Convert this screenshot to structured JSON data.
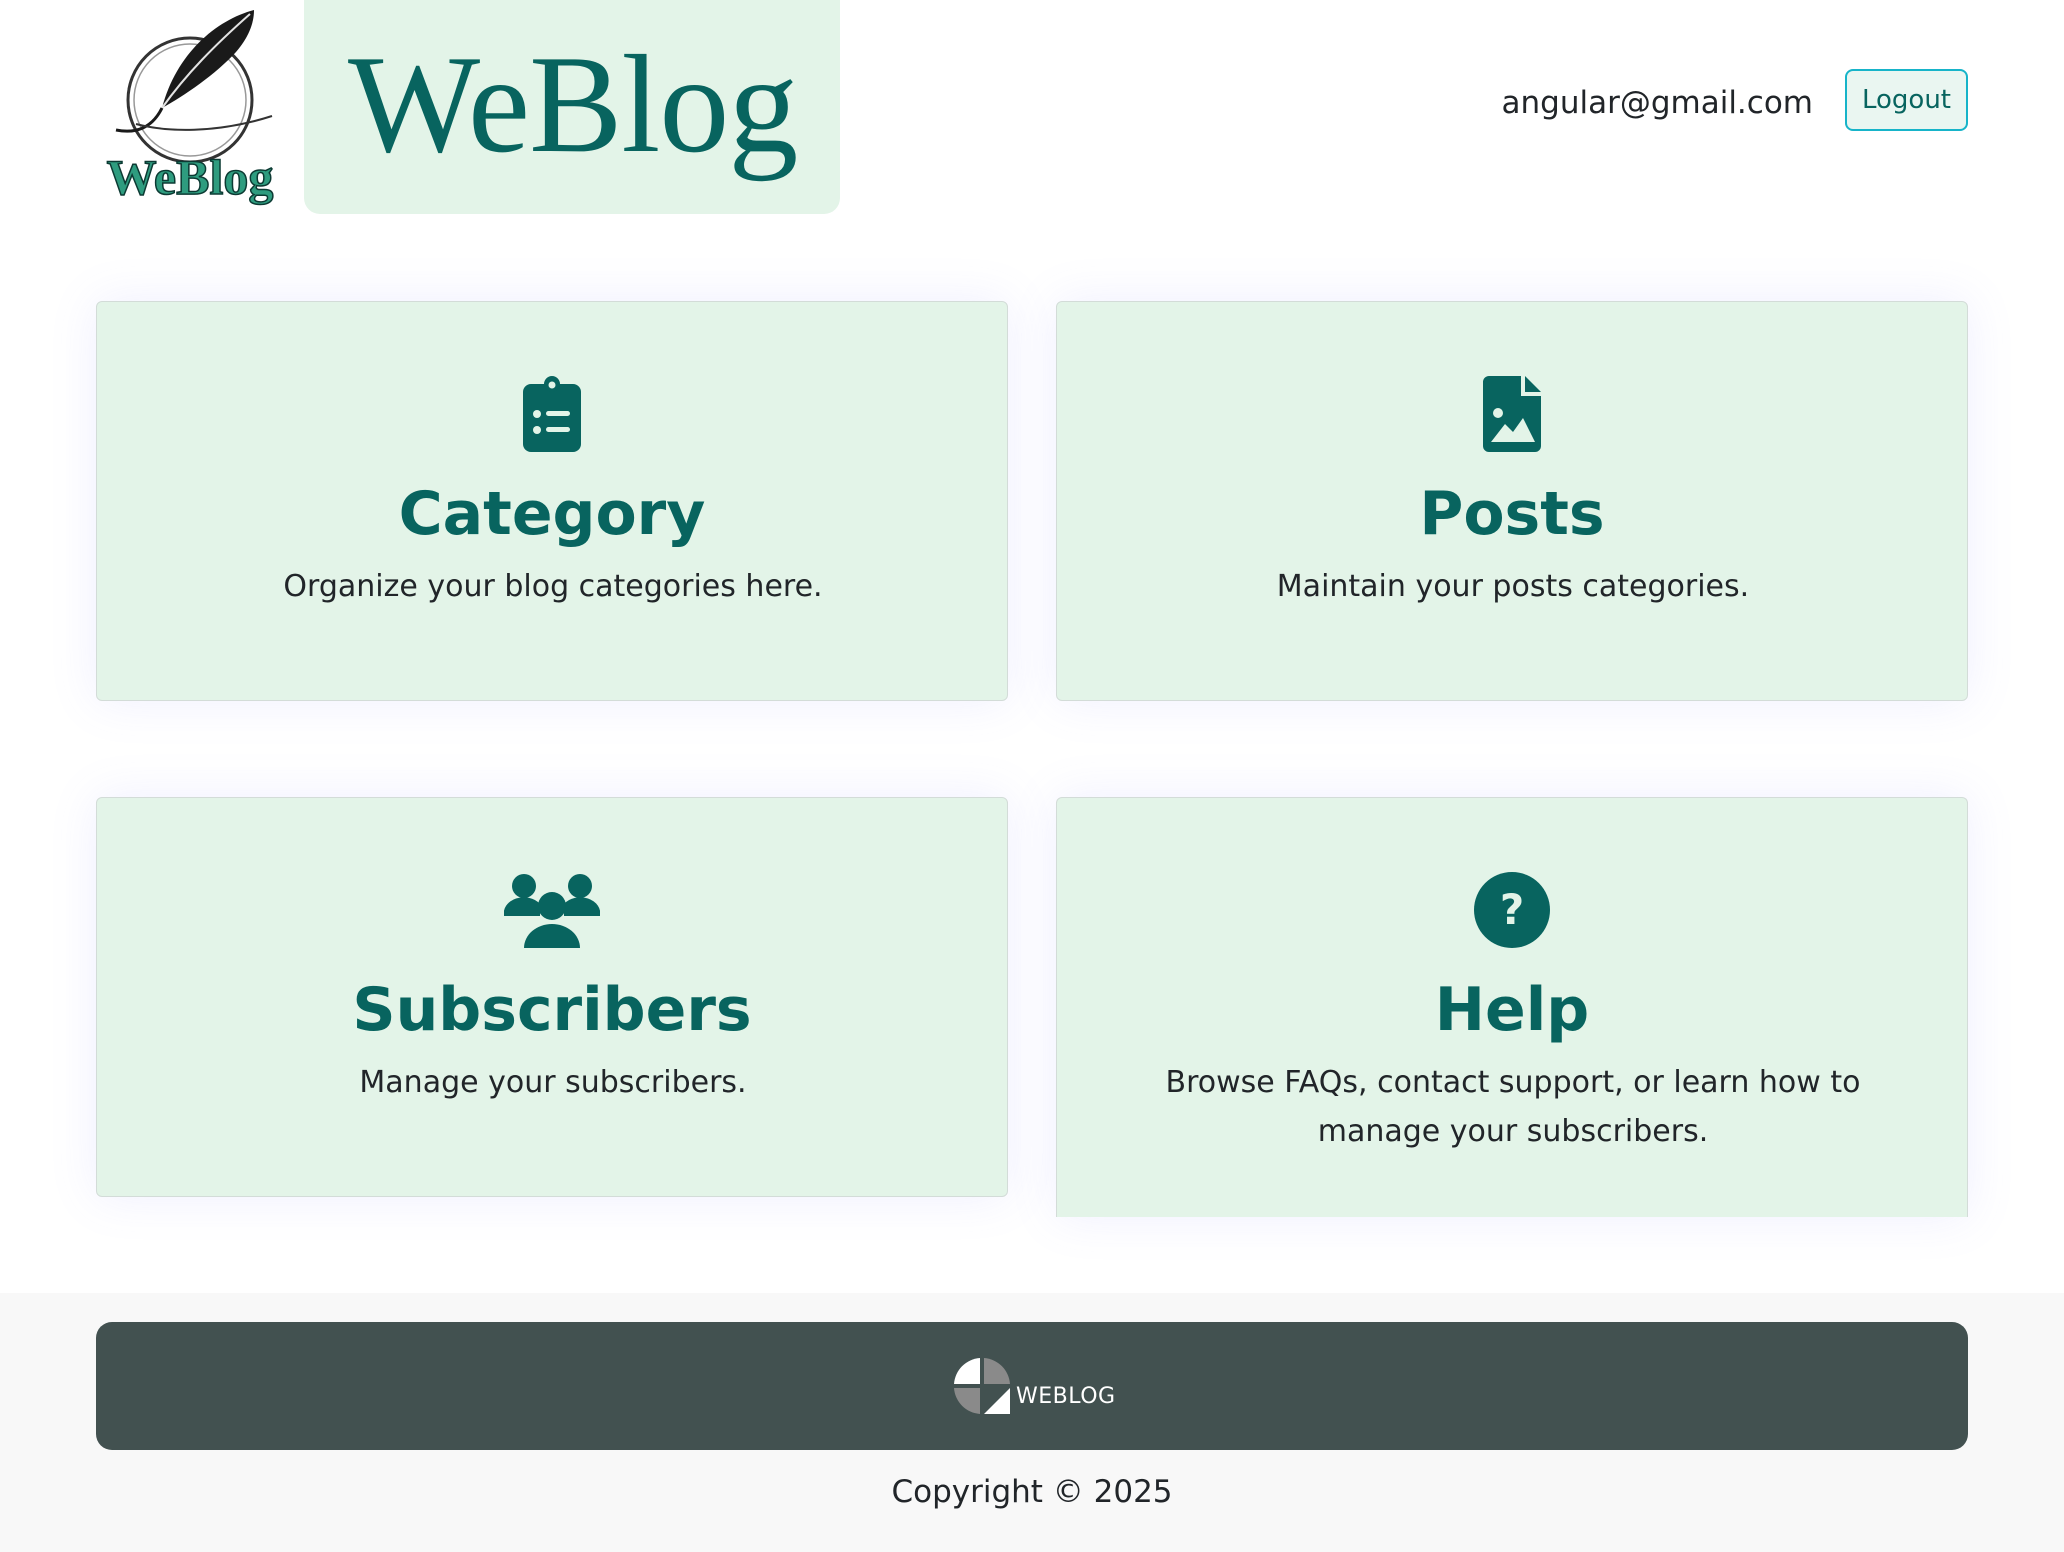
{
  "header": {
    "logo_text": "WeBlog",
    "brand_title": "WeBlog",
    "user_email": "angular@gmail.com",
    "logout_label": "Logout"
  },
  "cards": [
    {
      "icon": "clipboard-list-icon",
      "title": "Category",
      "description": "Organize your blog categories here."
    },
    {
      "icon": "file-image-icon",
      "title": "Posts",
      "description": "Maintain your posts categories."
    },
    {
      "icon": "users-icon",
      "title": "Subscribers",
      "description": "Manage your subscribers."
    },
    {
      "icon": "question-circle-icon",
      "title": "Help",
      "description": "Browse FAQs, contact support, or learn how to manage your subscribers."
    }
  ],
  "footer": {
    "logo_text": "WEBLOG",
    "copyright": "Copyright © 2025"
  },
  "colors": {
    "brand": "#08645f",
    "card_bg": "#e3f4e8",
    "footer_bar": "#425150",
    "logout_border": "#17b4c9"
  }
}
